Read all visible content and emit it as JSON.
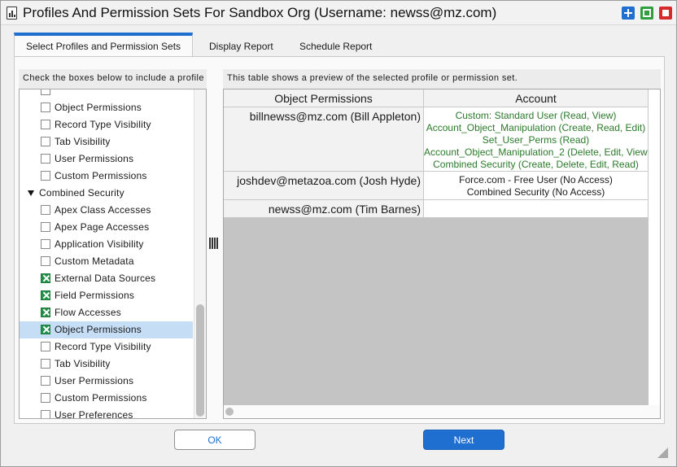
{
  "window": {
    "title": "Profiles And Permission Sets For Sandbox Org (Username: newss@mz.com)"
  },
  "tabs": [
    {
      "label": "Select Profiles and Permission Sets",
      "active": true
    },
    {
      "label": "Display Report",
      "active": false
    },
    {
      "label": "Schedule Report",
      "active": false
    }
  ],
  "left_panel": {
    "header": "Check the boxes below to include a profile or permission set in the report.",
    "tree": {
      "rows": [
        {
          "label": "",
          "checked": false,
          "partial": true
        },
        {
          "label": "Object Permissions",
          "checked": false
        },
        {
          "label": "Record Type Visibility",
          "checked": false
        },
        {
          "label": "Tab Visibility",
          "checked": false
        },
        {
          "label": "User Permissions",
          "checked": false
        },
        {
          "label": "Custom Permissions",
          "checked": false
        },
        {
          "label": "Combined Security",
          "group": true,
          "expanded": true
        },
        {
          "label": "Apex Class Accesses",
          "checked": false
        },
        {
          "label": "Apex Page Accesses",
          "checked": false
        },
        {
          "label": "Application Visibility",
          "checked": false
        },
        {
          "label": "Custom Metadata",
          "checked": false
        },
        {
          "label": "External Data Sources",
          "checked": true
        },
        {
          "label": "Field Permissions",
          "checked": true
        },
        {
          "label": "Flow Accesses",
          "checked": true
        },
        {
          "label": "Object Permissions",
          "checked": true,
          "selected": true
        },
        {
          "label": "Record Type Visibility",
          "checked": false
        },
        {
          "label": "Tab Visibility",
          "checked": false
        },
        {
          "label": "User Permissions",
          "checked": false
        },
        {
          "label": "Custom Permissions",
          "checked": false
        },
        {
          "label": "User Preferences",
          "checked": false
        }
      ]
    }
  },
  "right_panel": {
    "header": "This table shows a preview of the selected profile or permission set.",
    "table": {
      "columns": [
        "Object Permissions",
        "Account"
      ],
      "rows": [
        {
          "user": "billnewss@mz.com (Bill Appleton)",
          "lines": [
            "Custom: Standard User (Read, View)",
            "Account_Object_Manipulation (Create, Read, Edit)",
            "Set_User_Perms (Read)",
            "Account_Object_Manipulation_2 (Delete, Edit, View)",
            "Combined Security (Create, Delete, Edit, Read)"
          ],
          "color": "#2b7a2b"
        },
        {
          "user": "joshdev@metazoa.com (Josh Hyde)",
          "lines": [
            "Force.com - Free User (No Access)",
            "Combined Security (No Access)"
          ],
          "color": "#1a1a1a"
        },
        {
          "user": "newss@mz.com (Tim Barnes)",
          "lines": [],
          "color": "#1a1a1a"
        }
      ]
    }
  },
  "buttons": {
    "ok": "OK",
    "next": "Next"
  },
  "colors": {
    "accent": "#1e6fd0",
    "check_green": "#23914a",
    "permission_green": "#2b7a2b",
    "selection": "#c5ddf5"
  }
}
